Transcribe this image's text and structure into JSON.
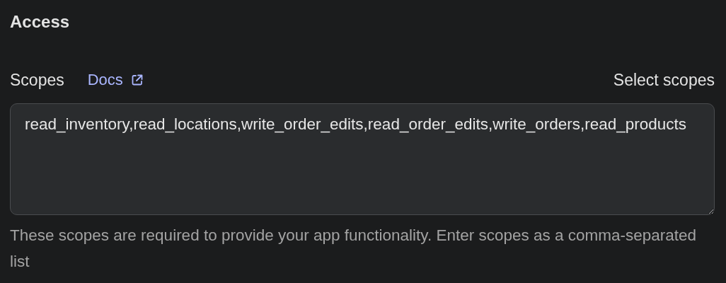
{
  "section": {
    "title": "Access"
  },
  "scopes": {
    "label": "Scopes",
    "docs_link": "Docs",
    "action": "Select scopes",
    "value": "read_inventory,read_locations,write_order_edits,read_order_edits,write_orders,read_products",
    "help": "These scopes are required to provide your app functionality. Enter scopes as a comma-separated list"
  }
}
